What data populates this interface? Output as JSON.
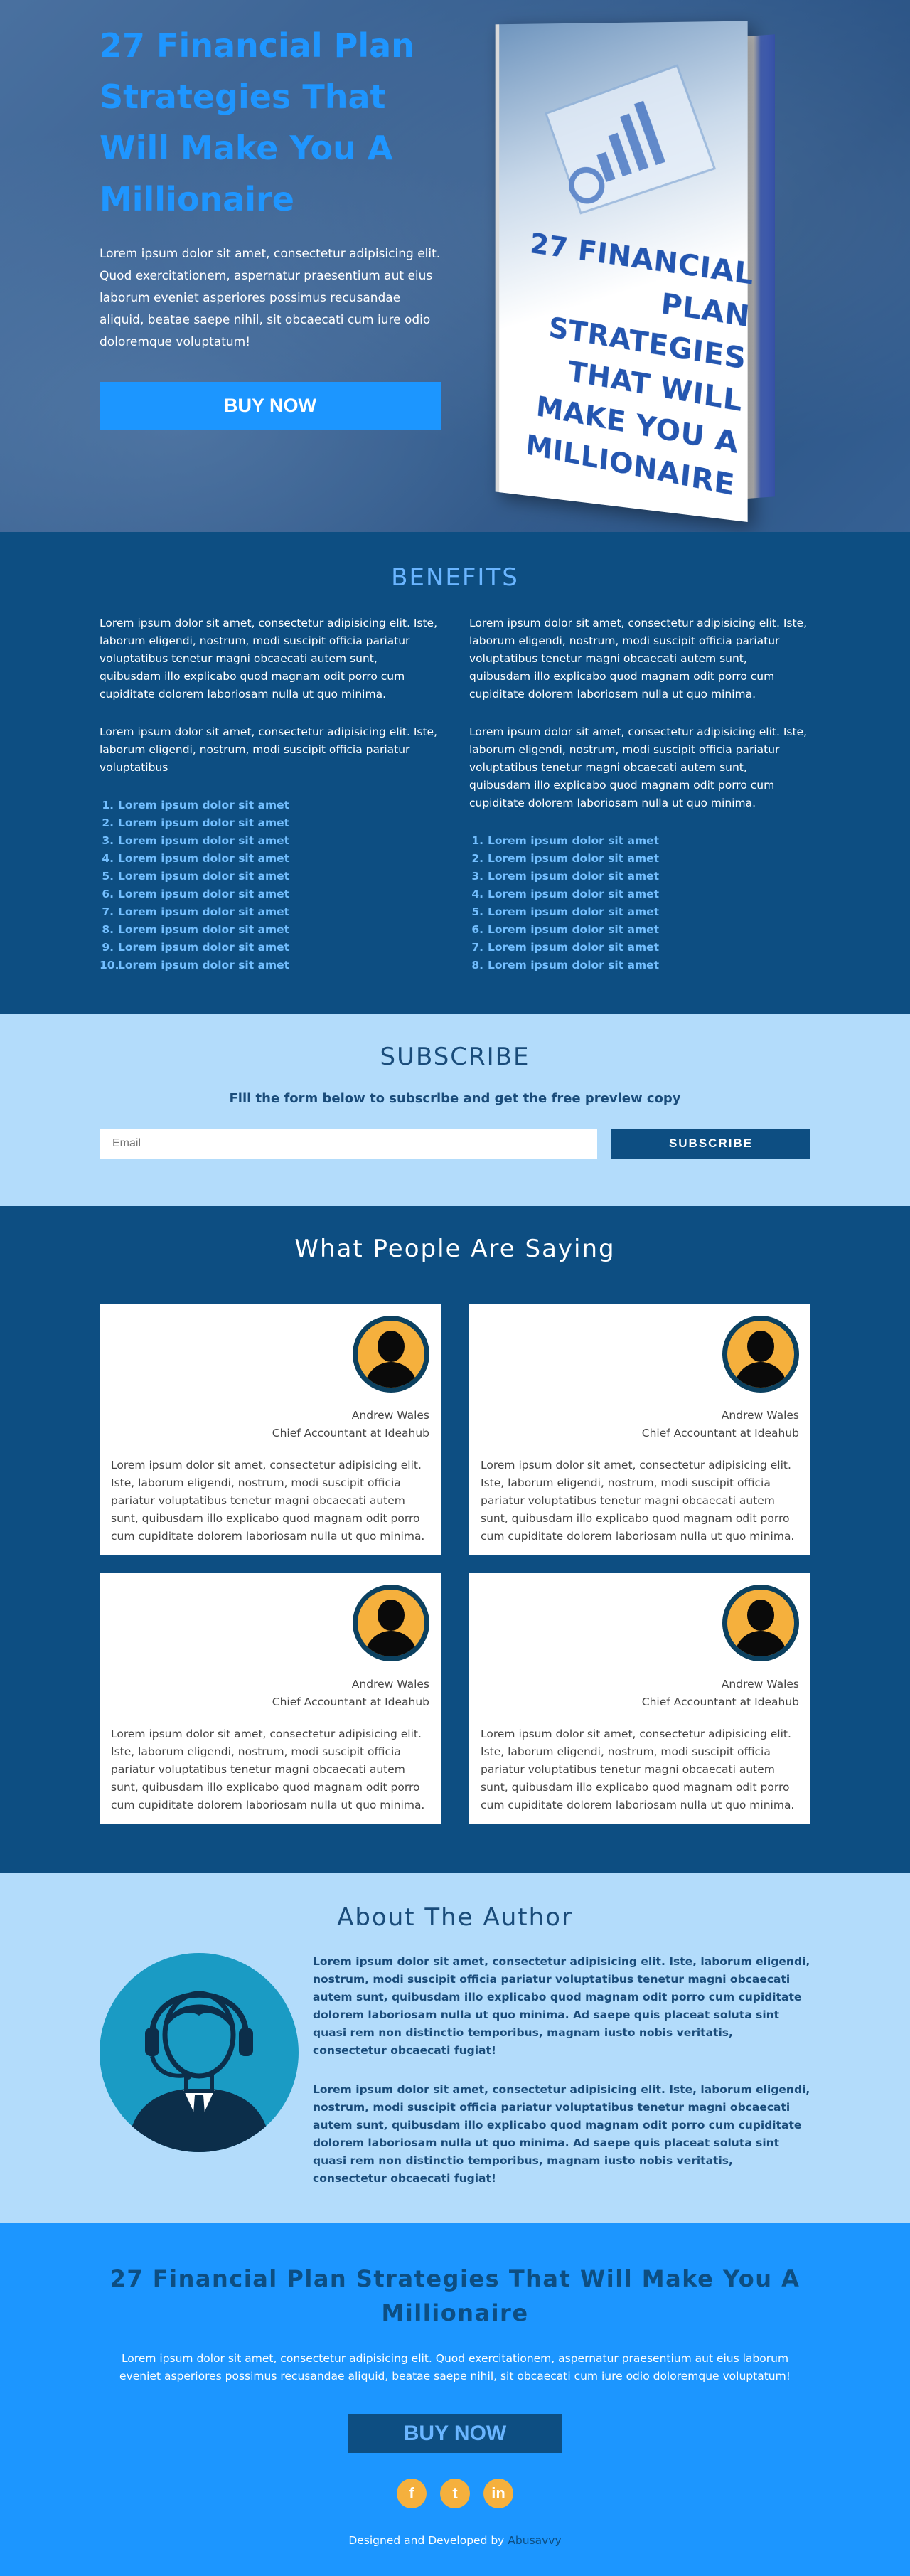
{
  "hero": {
    "title": "27 Financial Plan Strategies That Will Make You A Millionaire",
    "text": "Lorem ipsum dolor sit amet, consectetur adipisicing elit. Quod exercitationem, aspernatur praesentium aut eius laborum eveniet asperiores possimus recusandae aliquid, beatae saepe nihil, sit obcaecati cum iure odio doloremque voluptatum!",
    "buy_label": "BUY NOW",
    "book_title": "27 FINANCIAL PLAN STRATEGIES THAT WILL MAKE YOU A MILLIONAIRE"
  },
  "benefits": {
    "title": "BENEFITS",
    "left": {
      "p1": "Lorem ipsum dolor sit amet, consectetur adipisicing elit. Iste, laborum eligendi, nostrum, modi suscipit officia pariatur voluptatibus tenetur magni obcaecati autem sunt, quibusdam illo explicabo quod magnam odit porro cum cupiditate dolorem laboriosam nulla ut quo minima.",
      "p2": "Lorem ipsum dolor sit amet, consectetur adipisicing elit. Iste, laborum eligendi, nostrum, modi suscipit officia pariatur voluptatibus",
      "items": [
        "Lorem ipsum dolor sit amet",
        "Lorem ipsum dolor sit amet",
        "Lorem ipsum dolor sit amet",
        "Lorem ipsum dolor sit amet",
        "Lorem ipsum dolor sit amet",
        "Lorem ipsum dolor sit amet",
        "Lorem ipsum dolor sit amet",
        "Lorem ipsum dolor sit amet",
        "Lorem ipsum dolor sit amet",
        "Lorem ipsum dolor sit amet"
      ]
    },
    "right": {
      "p1": "Lorem ipsum dolor sit amet, consectetur adipisicing elit. Iste, laborum eligendi, nostrum, modi suscipit officia pariatur voluptatibus tenetur magni obcaecati autem sunt, quibusdam illo explicabo quod magnam odit porro cum cupiditate dolorem laboriosam nulla ut quo minima.",
      "p2": "Lorem ipsum dolor sit amet, consectetur adipisicing elit. Iste, laborum eligendi, nostrum, modi suscipit officia pariatur voluptatibus tenetur magni obcaecati autem sunt, quibusdam illo explicabo quod magnam odit porro cum cupiditate dolorem laboriosam nulla ut quo minima.",
      "items": [
        "Lorem ipsum dolor sit amet",
        "Lorem ipsum dolor sit amet",
        "Lorem ipsum dolor sit amet",
        "Lorem ipsum dolor sit amet",
        "Lorem ipsum dolor sit amet",
        "Lorem ipsum dolor sit amet",
        "Lorem ipsum dolor sit amet",
        "Lorem ipsum dolor sit amet"
      ]
    }
  },
  "subscribe": {
    "title": "SUBSCRIBE",
    "text": "Fill the form below to subscribe and get the free preview copy",
    "placeholder": "Email",
    "button": "SUBSCRIBE"
  },
  "testimonials": {
    "title": "What People Are Saying",
    "cards": [
      {
        "name": "Andrew Wales",
        "role": "Chief Accountant at Ideahub",
        "text": "Lorem ipsum dolor sit amet, consectetur adipisicing elit. Iste, laborum eligendi, nostrum, modi suscipit officia pariatur voluptatibus tenetur magni obcaecati autem sunt, quibusdam illo explicabo quod magnam odit porro cum cupiditate dolorem laboriosam nulla ut quo minima."
      },
      {
        "name": "Andrew Wales",
        "role": "Chief Accountant at Ideahub",
        "text": "Lorem ipsum dolor sit amet, consectetur adipisicing elit. Iste, laborum eligendi, nostrum, modi suscipit officia pariatur voluptatibus tenetur magni obcaecati autem sunt, quibusdam illo explicabo quod magnam odit porro cum cupiditate dolorem laboriosam nulla ut quo minima."
      },
      {
        "name": "Andrew Wales",
        "role": "Chief Accountant at Ideahub",
        "text": "Lorem ipsum dolor sit amet, consectetur adipisicing elit. Iste, laborum eligendi, nostrum, modi suscipit officia pariatur voluptatibus tenetur magni obcaecati autem sunt, quibusdam illo explicabo quod magnam odit porro cum cupiditate dolorem laboriosam nulla ut quo minima."
      },
      {
        "name": "Andrew Wales",
        "role": "Chief Accountant at Ideahub",
        "text": "Lorem ipsum dolor sit amet, consectetur adipisicing elit. Iste, laborum eligendi, nostrum, modi suscipit officia pariatur voluptatibus tenetur magni obcaecati autem sunt, quibusdam illo explicabo quod magnam odit porro cum cupiditate dolorem laboriosam nulla ut quo minima."
      }
    ]
  },
  "author": {
    "title": "About The Author",
    "p1": "Lorem ipsum dolor sit amet, consectetur adipisicing elit. Iste, laborum eligendi, nostrum, modi suscipit officia pariatur voluptatibus tenetur magni obcaecati autem sunt, quibusdam illo explicabo quod magnam odit porro cum cupiditate dolorem laboriosam nulla ut quo minima. Ad saepe quis placeat soluta sint quasi rem non distinctio temporibus, magnam iusto nobis veritatis, consectetur obcaecati fugiat!",
    "p2": "Lorem ipsum dolor sit amet, consectetur adipisicing elit. Iste, laborum eligendi, nostrum, modi suscipit officia pariatur voluptatibus tenetur magni obcaecati autem sunt, quibusdam illo explicabo quod magnam odit porro cum cupiditate dolorem laboriosam nulla ut quo minima. Ad saepe quis placeat soluta sint quasi rem non distinctio temporibus, magnam iusto nobis veritatis, consectetur obcaecati fugiat!"
  },
  "footer": {
    "title": "27 Financial Plan Strategies That Will Make You A Millionaire",
    "text": "Lorem ipsum dolor sit amet, consectetur adipisicing elit. Quod exercitationem, aspernatur praesentium aut eius laborum eveniet asperiores possimus recusandae aliquid, beatae saepe nihil, sit obcaecati cum iure odio doloremque voluptatum!",
    "buy_label": "BUY NOW",
    "social": [
      {
        "icon": "facebook-icon",
        "glyph": "f"
      },
      {
        "icon": "twitter-icon",
        "glyph": "t"
      },
      {
        "icon": "linkedin-icon",
        "glyph": "in"
      }
    ],
    "credit_prefix": "Designed and Developed by",
    "credit_link": "Abusavvy"
  },
  "colors": {
    "accent_blue": "#1c96ff",
    "navy": "#0d4e82",
    "light_blue": "#b3dcfb",
    "avatar_gold": "#f5b03d"
  }
}
